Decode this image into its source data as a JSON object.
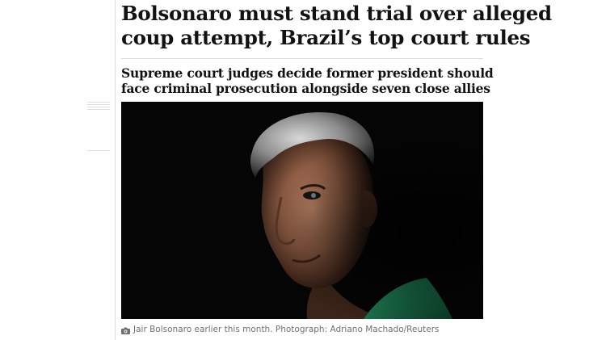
{
  "article": {
    "headline": "Bolsonaro must stand trial over alleged coup attempt, Brazil’s top court rules",
    "standfirst": "Supreme court judges decide former president should face criminal prosecution alongside seven close allies"
  },
  "photo": {
    "caption": "Jair Bolsonaro earlier this month. Photograph: Adriano Machado/Reuters",
    "caption_icon": "camera-icon"
  },
  "colors": {
    "text": "#121212",
    "caption": "#707070",
    "rule": "#dcdcdc",
    "photo_background": "#050505",
    "shirt": "#1d8a5a"
  }
}
